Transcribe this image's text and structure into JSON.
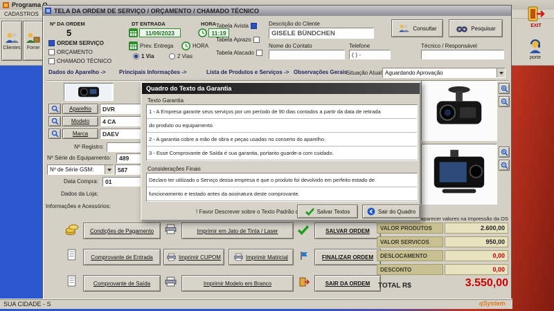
{
  "parent": {
    "title": "Programa O",
    "menu_cadastros": "CADASTROS",
    "btn_clientes": "Clientes",
    "btn_fornecedores": "Forne",
    "btn_exit": "EXIT",
    "btn_suporte": "porte",
    "status_left": "SUA CIDADE - S",
    "status_right": "qSystem"
  },
  "titlebar": {
    "title": "TELA DA ORDEM DE SERVIÇO / ORÇAMENTO / CHAMADO TÉCNICO"
  },
  "order": {
    "numero_label": "Nº DA ORDEM",
    "numero_value": "5",
    "chk_ordem_servico": "ORDEM SERVIÇO",
    "chk_orcamento": "ORÇAMENTO",
    "chk_chamado": "CHAMADO TÉCNICO",
    "dt_entrada_label": "DT ENTRADA",
    "hora_label": "HORA",
    "dt_entrada_value": "11/09/2023",
    "hora_value": "11:19",
    "prev_entrega_label": "Prev. Entrega",
    "prev_hora_label": "HORA",
    "via_1": "1 Via",
    "via_2": "2 Vias",
    "chk_tabela_avista": "Tabela Avista",
    "chk_tabela_aprazo": "Tabela Aprazo",
    "chk_tabela_atacado": "Tabela Atacado"
  },
  "client": {
    "descricao_label": "Descrição do Cliente",
    "descricao_value": "GISELE BÜNDCHEN",
    "contato_label": "Nome do Contato",
    "telefone_label": "Telefone",
    "telefone_value": "( )      -",
    "tecnico_label": "Técnico / Responsável",
    "btn_consultar": "Consultar",
    "btn_pesquisar": "Pesquisar"
  },
  "tabs": {
    "tab_dados": "Dados do Aparelho ->",
    "tab_principais": "Principais Informações ->",
    "tab_lista": "Lista de Produtos e Serviços ->",
    "tab_obs": "Observações Gerais",
    "situacao_label": "Situação Atual:",
    "situacao_value": "Aguardando Aprovação"
  },
  "device": {
    "btn_aparelho": "Aparelho",
    "aparelho_value": "DVR",
    "btn_modelo": "Modelo",
    "modelo_value": "4 CA",
    "btn_marca": "Marca",
    "marca_value": "DAEV",
    "registro_label": "Nº Registro:",
    "serie_label": "Nº Série do Equipamento:",
    "serie_value": "489",
    "gsm_label": "Nº de Série GSM:",
    "gsm_value": "587",
    "compra_label": "Data Compra:",
    "compra_value": "01",
    "loja_label": "Dados da Loja:",
    "info_label": "Informações e Acessórios:"
  },
  "dialog": {
    "title": "Quadro do Texto da Garantia",
    "garantia_label": "Texto Garantia",
    "garantia_lines": [
      "1 - A Empresa garante seus serviços por um período de 90 dias contados a partir da data de retirada",
      "do produto ou equipamento.",
      "2 - A garantia cobre a mão de obra e peças usadas no conserto do aparelho.",
      "3 - Esse Comprovante de Saída é sua garantia, portanto guarde-a com cuidado."
    ],
    "consideracoes_label": "Considerações Finais",
    "consideracoes_lines": [
      "Declaro ter utilizado o Serviço dessa empresa e que o produto foi devolvido em perfeito estado de",
      "funcionamento e testado antes da assinatura deste comprovante."
    ],
    "hint": "! Favor Descrever sobre o Texto Padrão da Garantia.",
    "btn_salvar": "Salvar Textos",
    "btn_sair": "Sair do Quadro"
  },
  "actions": {
    "condicoes": "Condições de Pagamento",
    "comp_entrada": "Comprovante de Entrada",
    "comp_saida": "Comprovante de Saída",
    "imp_jato": "Imprimir em Jato de Tinta / Laser",
    "imp_cupom": "Imprimir CUPOM",
    "imp_matricial": "Imprimir Matricial",
    "imp_branco": "Imprimir Modelo em Branco",
    "salvar_ordem": "SALVAR ORDEM",
    "finalizar_ordem": "FINALIZAR ORDEM",
    "sair_ordem": "SAIR DA ORDEM"
  },
  "totals": {
    "nota": "aparecer valores na Impressão da OS",
    "rows": [
      {
        "label": "VALOR PRODUTOS",
        "value": "2.600,00"
      },
      {
        "label": "VALOR SERVICOS",
        "value": "950,00"
      },
      {
        "label": "DESLOCAMENTO",
        "value": "0,00"
      },
      {
        "label": "DESCONTO",
        "value": "0,00"
      }
    ],
    "total_label": "TOTAL R$",
    "total_value": "3.550,00"
  },
  "colors": {
    "accent_red": "#cc0000",
    "khaki_label": "#c8c093",
    "khaki_value": "#e7e3c1",
    "green_field": "#2e8b2e"
  }
}
